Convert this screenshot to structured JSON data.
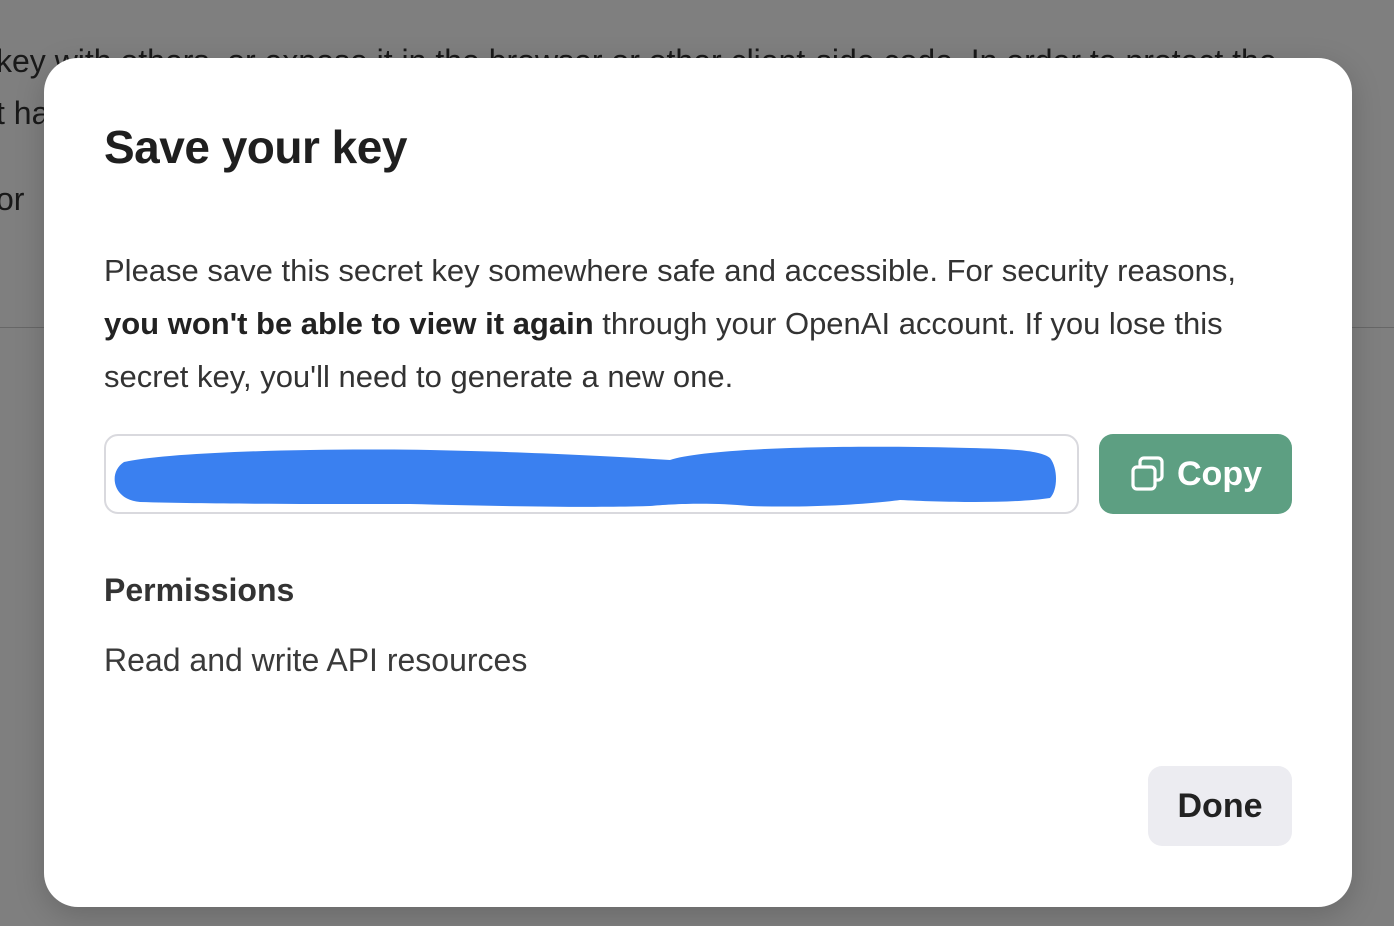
{
  "background": {
    "line1": "key with others, or expose it in the browser or other client-side code. In order to protect the",
    "line2": "t ha",
    "line3": "or"
  },
  "modal": {
    "title": "Save your key",
    "description_part1": "Please save this secret key somewhere safe and accessible. For security reasons, ",
    "description_bold": "you won't be able to view it again",
    "description_part2": " through your OpenAI account. If you lose this secret key, you'll need to generate a new one.",
    "copy_label": "Copy",
    "permissions_heading": "Permissions",
    "permissions_value": "Read and write API resources",
    "done_label": "Done"
  },
  "colors": {
    "copy_button": "#5d9f82",
    "redaction": "#3a80f0",
    "done_button": "#ececf1"
  },
  "icons": {
    "copy": "copy-icon"
  }
}
